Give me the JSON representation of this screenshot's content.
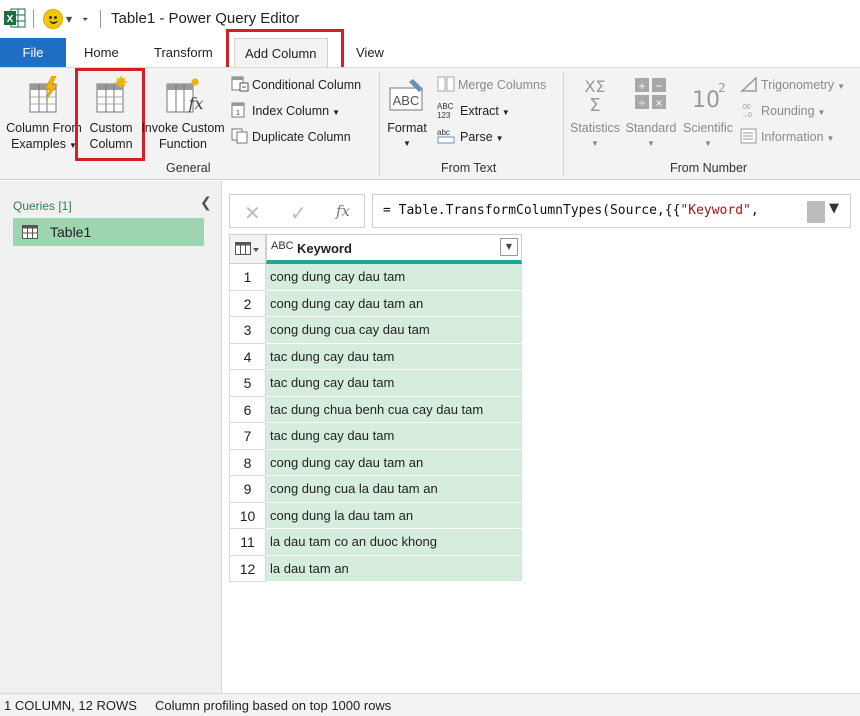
{
  "window": {
    "title": "Table1 - Power Query Editor"
  },
  "tabs": {
    "file": "File",
    "home": "Home",
    "transform": "Transform",
    "add_column": "Add Column",
    "view": "View"
  },
  "ribbon": {
    "general": {
      "label": "General",
      "column_from_examples": [
        "Column From",
        "Examples"
      ],
      "custom_column": [
        "Custom",
        "Column"
      ],
      "invoke_custom_function": [
        "Invoke Custom",
        "Function"
      ],
      "conditional_column": "Conditional Column",
      "index_column": "Index Column",
      "duplicate_column": "Duplicate Column"
    },
    "from_text": {
      "label": "From Text",
      "format": "Format",
      "merge_columns": "Merge Columns",
      "extract": "Extract",
      "parse": "Parse"
    },
    "from_number": {
      "label": "From Number",
      "statistics": "Statistics",
      "standard": "Standard",
      "scientific": "Scientific",
      "trigonometry": "Trigonometry",
      "rounding": "Rounding",
      "information": "Information"
    }
  },
  "queries": {
    "header": "Queries [1]",
    "items": [
      "Table1"
    ]
  },
  "formula": {
    "prefix": "= Table.TransformColumnTypes(Source,{{",
    "string": "\"Keyword\"",
    "suffix": ","
  },
  "grid": {
    "column_type": "ABC",
    "column_header": "Keyword",
    "rows": [
      {
        "n": "1",
        "value": "cong dung cay dau tam"
      },
      {
        "n": "2",
        "value": "cong dung cay dau tam an"
      },
      {
        "n": "3",
        "value": "cong dung cua cay dau tam"
      },
      {
        "n": "4",
        "value": "tac dung cay dau tam"
      },
      {
        "n": "5",
        "value": "tac dung cay dau tam"
      },
      {
        "n": "6",
        "value": "tac dung chua benh cua cay dau tam"
      },
      {
        "n": "7",
        "value": "tac dung cay dau tam"
      },
      {
        "n": "8",
        "value": "cong dung cay dau tam an"
      },
      {
        "n": "9",
        "value": "cong dung cua la dau tam an"
      },
      {
        "n": "10",
        "value": "cong dung la dau tam an"
      },
      {
        "n": "11",
        "value": "la dau tam co an duoc khong"
      },
      {
        "n": "12",
        "value": "la dau tam an"
      }
    ]
  },
  "status": {
    "summary": "1 COLUMN, 12 ROWS",
    "profiling": "Column profiling based on top 1000 rows"
  },
  "colors": {
    "file_tab": "#1f6fc4",
    "highlight_box": "#d31f26",
    "query_selected": "#9fd4b0",
    "column_accent": "#1fa39a",
    "cell_fill": "#d6ecdc"
  }
}
